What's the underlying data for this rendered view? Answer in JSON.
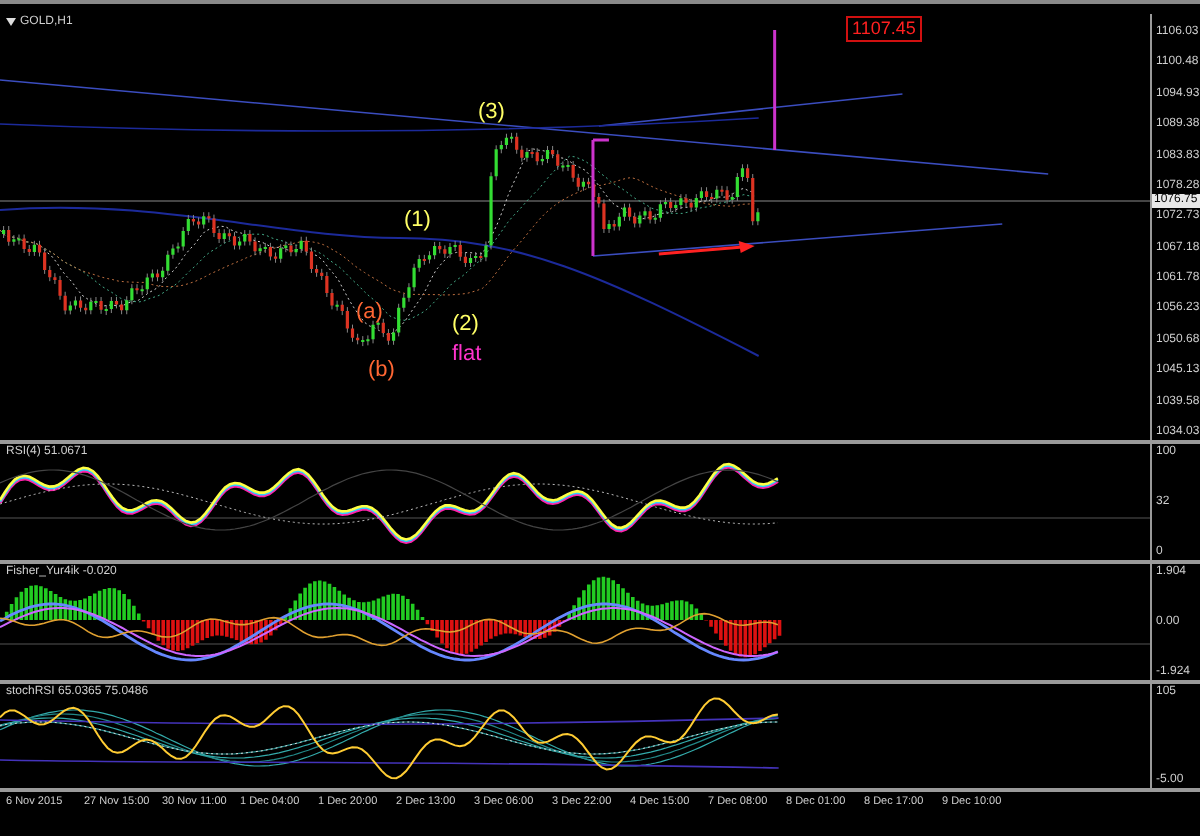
{
  "chart": {
    "title": "GOLD,H1",
    "price_tag": "1107.45",
    "current_price": "1076.75",
    "price_axis": [
      "1106.03",
      "1100.48",
      "1094.93",
      "1089.38",
      "1083.83",
      "1078.28",
      "1072.73",
      "1067.18",
      "1061.78",
      "1056.23",
      "1050.68",
      "1045.13",
      "1039.58",
      "1034.03"
    ],
    "wave_labels": [
      {
        "text": "(3)",
        "color": "#ffff66"
      },
      {
        "text": "(1)",
        "color": "#ffff66"
      },
      {
        "text": "(a)",
        "color": "#ff6633"
      },
      {
        "text": "(2)",
        "color": "#ffff66"
      },
      {
        "text": "flat",
        "color": "#ff33cc"
      },
      {
        "text": "(b)",
        "color": "#ff6633"
      }
    ]
  },
  "indicators": [
    {
      "kind": "rsi",
      "title": "RSI(4) 51.0671",
      "levels": [
        "100",
        "32",
        "0"
      ]
    },
    {
      "kind": "fisher",
      "title": "Fisher_Yur4ik -0.020",
      "levels": [
        "1.904",
        "0.00",
        "-1.924"
      ]
    },
    {
      "kind": "stoch",
      "title": "stochRSI 65.0365 75.0486",
      "levels": [
        "105",
        "-5.00"
      ]
    }
  ],
  "time_axis": [
    "6 Nov 2015",
    "27 Nov 15:00",
    "30 Nov 11:00",
    "1 Dec 04:00",
    "1 Dec 20:00",
    "2 Dec 13:00",
    "3 Dec 06:00",
    "3 Dec 22:00",
    "4 Dec 15:00",
    "7 Dec 08:00",
    "8 Dec 01:00",
    "8 Dec 17:00",
    "9 Dec 10:00"
  ]
}
